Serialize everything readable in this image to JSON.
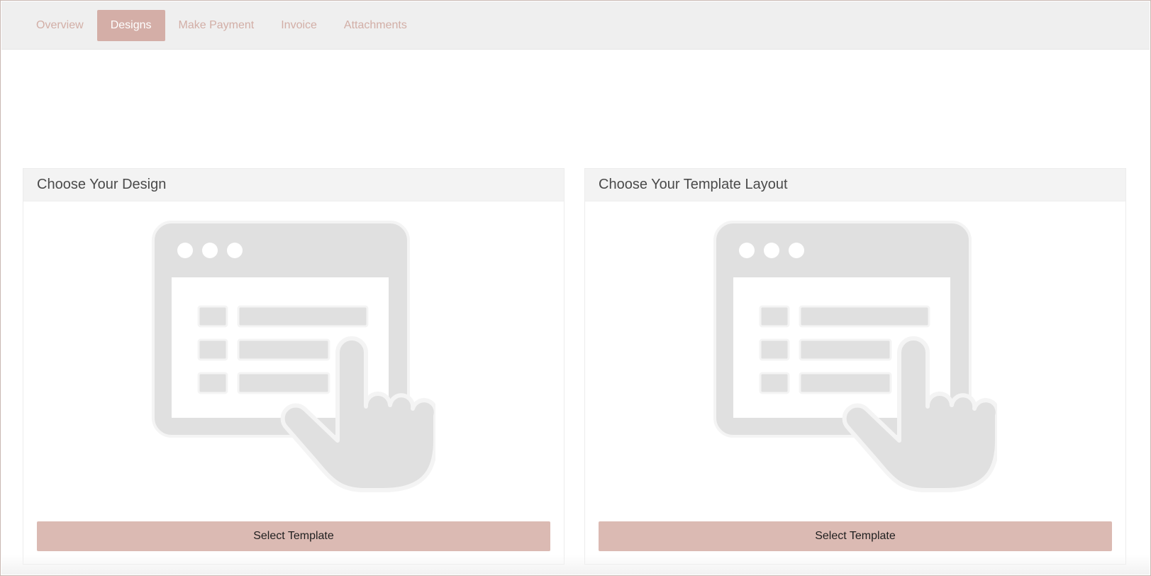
{
  "tabs": [
    {
      "label": "Overview",
      "active": false
    },
    {
      "label": "Designs",
      "active": true
    },
    {
      "label": "Make Payment",
      "active": false
    },
    {
      "label": "Invoice",
      "active": false
    },
    {
      "label": "Attachments",
      "active": false
    }
  ],
  "panels": [
    {
      "title": "Choose Your Design",
      "button_label": "Select Template",
      "icon": "browser-click-icon"
    },
    {
      "title": "Choose Your Template Layout",
      "button_label": "Select Template",
      "icon": "browser-click-icon"
    }
  ],
  "colors": {
    "accent": "#d4aea7",
    "button": "#dbbab3",
    "tab_text": "#d2aea6",
    "icon_gray": "#e0e0e0"
  }
}
